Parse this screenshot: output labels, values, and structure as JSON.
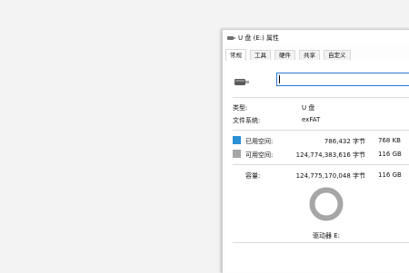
{
  "window": {
    "title": "U 盘 (E:) 属性"
  },
  "tabs": [
    "常规",
    "工具",
    "硬件",
    "共享",
    "自定义"
  ],
  "general": {
    "name_value": "",
    "type_label": "类型:",
    "type_value": "U 盘",
    "fs_label": "文件系统:",
    "fs_value": "exFAT",
    "used_label": "已用空间:",
    "used_bytes": "786,432 字节",
    "used_size": "768 KB",
    "free_label": "可用空间:",
    "free_bytes": "124,774,383,616 字节",
    "free_size": "116 GB",
    "capacity_label": "容量:",
    "capacity_bytes": "124,775,170,048 字节",
    "capacity_size": "116 GB",
    "drive_label": "驱动器 E:"
  },
  "usage": {
    "used_fraction": 6.3e-06
  },
  "colors": {
    "used": "#2b8fd4",
    "free": "#a6a6a6",
    "accent": "#2b79d6"
  },
  "icons": {
    "title": "usb-drive-icon",
    "drive": "usb-drive-icon"
  }
}
